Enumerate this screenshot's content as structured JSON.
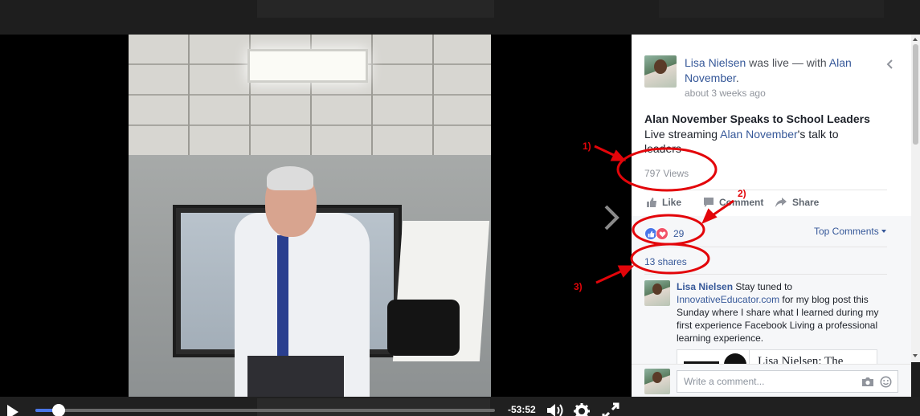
{
  "video": {
    "time_remaining": "-53:52",
    "progress_fraction": 0.05
  },
  "post": {
    "author": "Lisa Nielsen",
    "live_text": " was live — with ",
    "tagged": "Alan November",
    "tagged_suffix": ".",
    "timestamp": "about 3 weeks ago",
    "title": "Alan November Speaks to School Leaders",
    "desc_prefix": "Live streaming ",
    "desc_link": "Alan November",
    "desc_suffix": "'s talk to leaders",
    "views": "797 Views"
  },
  "actions": {
    "like": "Like",
    "comment": "Comment",
    "share": "Share"
  },
  "summary": {
    "reaction_count": "29",
    "top_comments": "Top Comments",
    "shares": "13 shares"
  },
  "comment": {
    "author": "Lisa Nielsen",
    "text_before": " Stay tuned to ",
    "link": "InnovativeEducator.com",
    "text_after": " for my blog post this Sunday where I share what I learned during my first experience Facebook Living a professional learning experience.",
    "preview_title": "Lisa Nielsen: The"
  },
  "composer": {
    "placeholder": "Write a comment..."
  },
  "annotations": {
    "label_1": "1)",
    "label_2": "2)",
    "label_3": "3)",
    "color": "#e3050a"
  },
  "colors": {
    "facebook_blue": "#365899",
    "progress_blue": "#4a76e8",
    "love_red": "#f25268"
  }
}
